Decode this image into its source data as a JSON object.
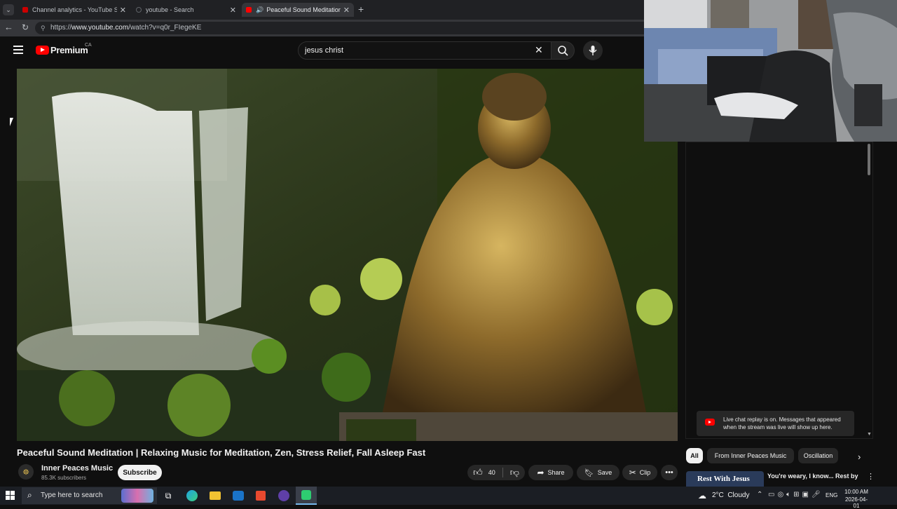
{
  "browser": {
    "tabs": [
      {
        "title": "Channel analytics - YouTube Studi",
        "fav": "#cc0000"
      },
      {
        "title": "youtube - Search",
        "fav": "#5f6368"
      },
      {
        "title": "Peaceful Sound Meditation | R",
        "fav": "#ff0000"
      }
    ],
    "url_prefix": "https://",
    "url_host": "www.youtube.com",
    "url_path": "/watch?v=q0r_FIegeKE"
  },
  "youtube": {
    "logo": "Premium",
    "region": "CA",
    "search_value": "jesus christ"
  },
  "video": {
    "title": "Peaceful Sound Meditation | Relaxing Music for Meditation, Zen, Stress Relief, Fall Asleep Fast",
    "channel": "Inner Peaces Music",
    "subscribers": "85.3K subscribers",
    "subscribe_label": "Subscribe",
    "likes": "40",
    "share_label": "Share",
    "save_label": "Save",
    "clip_label": "Clip"
  },
  "chat": {
    "replay_notice": "Live chat replay is on. Messages that appeared when the stream was live will show up here."
  },
  "chips": [
    "All",
    "From Inner Peaces Music",
    "Oscillation"
  ],
  "recommended": {
    "thumb_text": "Rest With Jesus",
    "title": "You're weary, I know... Rest by"
  },
  "taskbar": {
    "search_placeholder": "Type here to search",
    "weather": "2°C  Cloudy",
    "lang": "ENG",
    "time": "10:00 AM",
    "date": "2026-04-01"
  },
  "colors": {
    "accent": "#ff0000",
    "bg": "#0f0f0f"
  }
}
